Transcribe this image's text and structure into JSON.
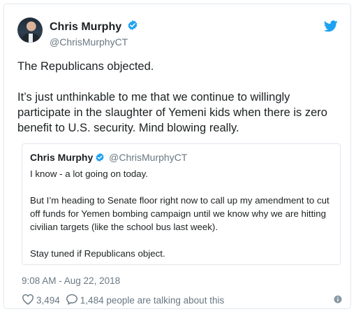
{
  "tweet": {
    "author_name": "Chris Murphy",
    "author_handle": "@ChrisMurphyCT",
    "paragraphs": [
      "The Republicans objected.",
      "It’s just unthinkable to me that we continue to willingly participate in the slaughter of Yemeni kids when there is zero benefit to U.S. security. Mind blowing really."
    ],
    "timestamp": "9:08 AM - Aug 22, 2018",
    "likes": "3,494",
    "talking": "1,484 people are talking about this"
  },
  "quoted": {
    "author_name": "Chris Murphy",
    "author_handle": "@ChrisMurphyCT",
    "paragraphs": [
      "I know - a lot going on today.",
      "But I’m heading to Senate floor right now to call up my amendment to cut off funds for Yemen bombing campaign until we know why we are hitting civilian targets (like the school bus last week).",
      "Stay tuned if Republicans object."
    ]
  },
  "colors": {
    "verified_blue": "#1da1f2",
    "twitter_blue": "#1da1f2",
    "muted_text": "#697882",
    "border": "#e1e8ed"
  },
  "icons": {
    "verified": "verified-badge-icon",
    "twitter": "twitter-bird-icon",
    "like": "heart-icon",
    "reply": "speech-bubble-icon",
    "info": "info-icon"
  }
}
